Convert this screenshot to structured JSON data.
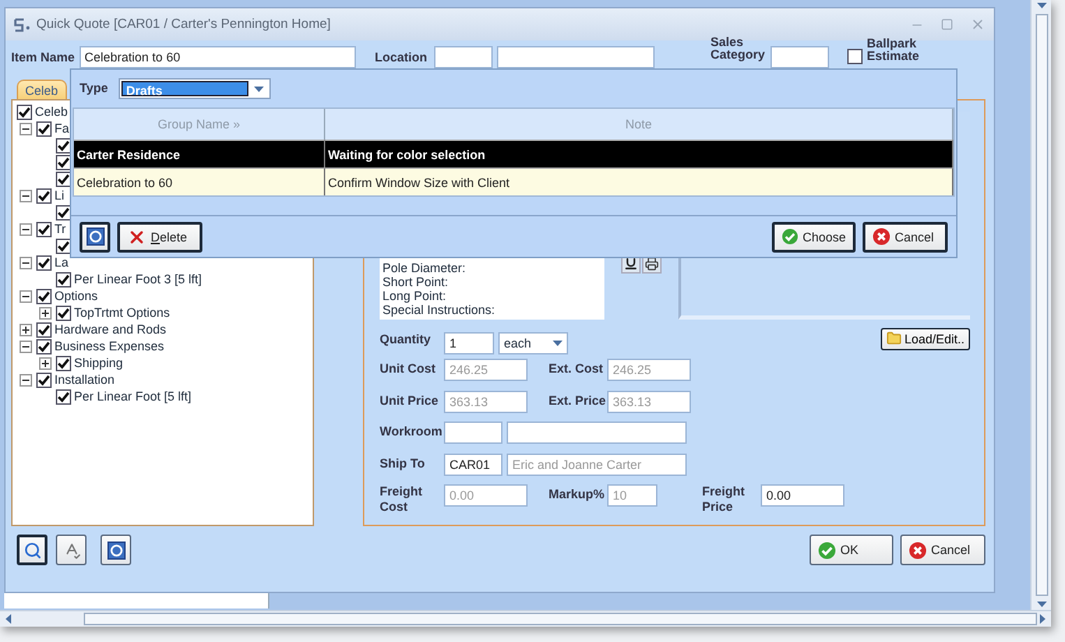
{
  "window": {
    "title": "Quick Quote [CAR01 / Carter's Pennington Home]"
  },
  "header": {
    "item_name": {
      "label": "Item Name",
      "value": "Celebration to  60"
    },
    "location": {
      "label": "Location"
    },
    "sales_category": {
      "label": "Sales Category"
    },
    "ballpark": {
      "label": "Ballpark Estimate",
      "checked": false
    }
  },
  "tab": {
    "label": "Celeb",
    "selected": true
  },
  "tree": [
    {
      "label": "Celeb",
      "checked": true,
      "children": [
        {
          "label": "Fa",
          "checked": true,
          "expanded": true,
          "children": [
            {
              "checked": true
            },
            {
              "checked": true
            },
            {
              "checked": true
            }
          ]
        },
        {
          "label": "Li",
          "checked": true,
          "expanded": true,
          "children": [
            {
              "checked": true
            }
          ]
        },
        {
          "label": "Tr",
          "checked": true,
          "expanded": true,
          "children": [
            {
              "checked": true
            }
          ]
        },
        {
          "label": "La",
          "checked": true,
          "expanded": true,
          "children": [
            {
              "label": "Per Linear Foot 3 [5 lft]",
              "checked": true
            }
          ]
        },
        {
          "label": "Options",
          "checked": true,
          "expanded": true,
          "children": [
            {
              "label": "TopTrtmt Options",
              "checked": true,
              "expanded": false
            }
          ]
        },
        {
          "label": "Hardware and Rods",
          "checked": true,
          "expanded": false
        },
        {
          "label": "Business Expenses",
          "checked": true,
          "expanded": true,
          "children": [
            {
              "label": "Shipping",
              "checked": true,
              "expanded": false
            }
          ]
        },
        {
          "label": "Installation",
          "checked": true,
          "expanded": true,
          "children": [
            {
              "label": "Per Linear Foot [5 lft]",
              "checked": true
            }
          ]
        }
      ]
    }
  ],
  "notes": {
    "lines": [
      "Pole Diameter:",
      "Short Point:",
      "Long Point:",
      "Special Instructions:"
    ]
  },
  "load_button": "Load/Edit..",
  "quantity": {
    "label": "Quantity",
    "value": "1",
    "unit": "each"
  },
  "form_rows": [
    {
      "kind": "pair",
      "fields": [
        {
          "label": "Unit Cost",
          "value": "246.25",
          "disabled": true
        },
        {
          "label": "Ext. Cost",
          "value": "246.25",
          "disabled": true
        }
      ]
    },
    {
      "kind": "pair",
      "fields": [
        {
          "label": "Unit Price",
          "value": "363.13",
          "disabled": true
        },
        {
          "label": "Ext. Price",
          "value": "363.13",
          "disabled": true
        }
      ]
    },
    {
      "kind": "split",
      "label": "Workroom"
    },
    {
      "kind": "split",
      "label": "Ship To",
      "inputs": [
        {
          "value": "CAR01",
          "disabled": false
        },
        {
          "value": "Eric and Joanne Carter",
          "disabled": true
        }
      ]
    },
    {
      "kind": "pair",
      "fields": [
        {
          "label": "Freight Cost",
          "value": "0.00",
          "disabled": true
        },
        {
          "label": "Markup%",
          "value": "10",
          "disabled": true
        },
        {
          "label": "Freight Price",
          "value": "0.00",
          "disabled": false
        }
      ]
    }
  ],
  "buttons": [
    "OK",
    "Cancel"
  ],
  "popup": {
    "type_label": "Type",
    "type_value": "Drafts",
    "columns": [
      "Group Name »",
      "Note"
    ],
    "rows": [
      {
        "cells": [
          "Carter Residence",
          "Waiting for color selection"
        ],
        "selected": true
      },
      {
        "cells": [
          "Celebration to  60",
          "Confirm Window Size with Client"
        ],
        "selected": false
      }
    ],
    "delete": "Delete",
    "choose": "Choose",
    "cancel": "Cancel"
  }
}
